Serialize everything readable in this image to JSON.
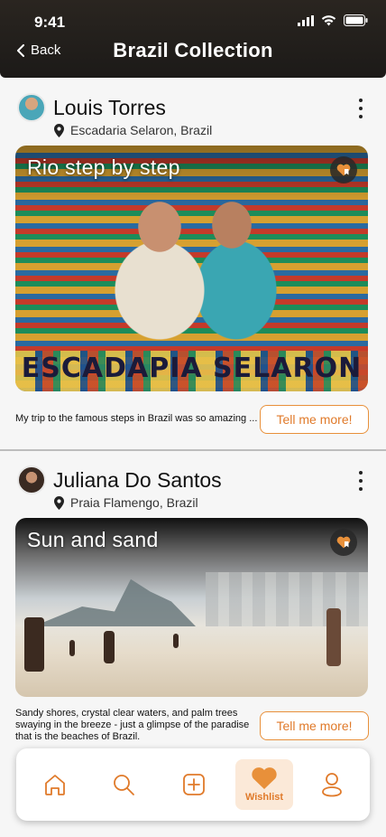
{
  "status": {
    "time": "9:41"
  },
  "header": {
    "back_label": "Back",
    "title": "Brazil Collection"
  },
  "posts": [
    {
      "user": "Louis Torres",
      "location": "Escadaria Selaron, Brazil",
      "photo_title": "Rio step by step",
      "photo_sign": "ESCADAPIA SELARON",
      "caption": "My trip to the famous steps in Brazil was so amazing ...",
      "cta": "Tell me more!"
    },
    {
      "user": "Juliana Do Santos",
      "location": "Praia Flamengo, Brazil",
      "photo_title": "Sun and sand",
      "caption": "Sandy shores, crystal clear waters, and palm trees swaying in the breeze - just a glimpse of the paradise that is the beaches of Brazil.",
      "cta": "Tell me more!"
    }
  ],
  "bottom_nav": {
    "items": [
      {
        "icon": "home-icon"
      },
      {
        "icon": "search-icon"
      },
      {
        "icon": "add-icon"
      },
      {
        "icon": "heart-icon",
        "label": "Wishlist",
        "active": true
      },
      {
        "icon": "profile-icon"
      }
    ]
  },
  "colors": {
    "accent": "#e07a2a",
    "accent_bg": "#fbe9d8",
    "header_bg": "#1c1a18"
  }
}
